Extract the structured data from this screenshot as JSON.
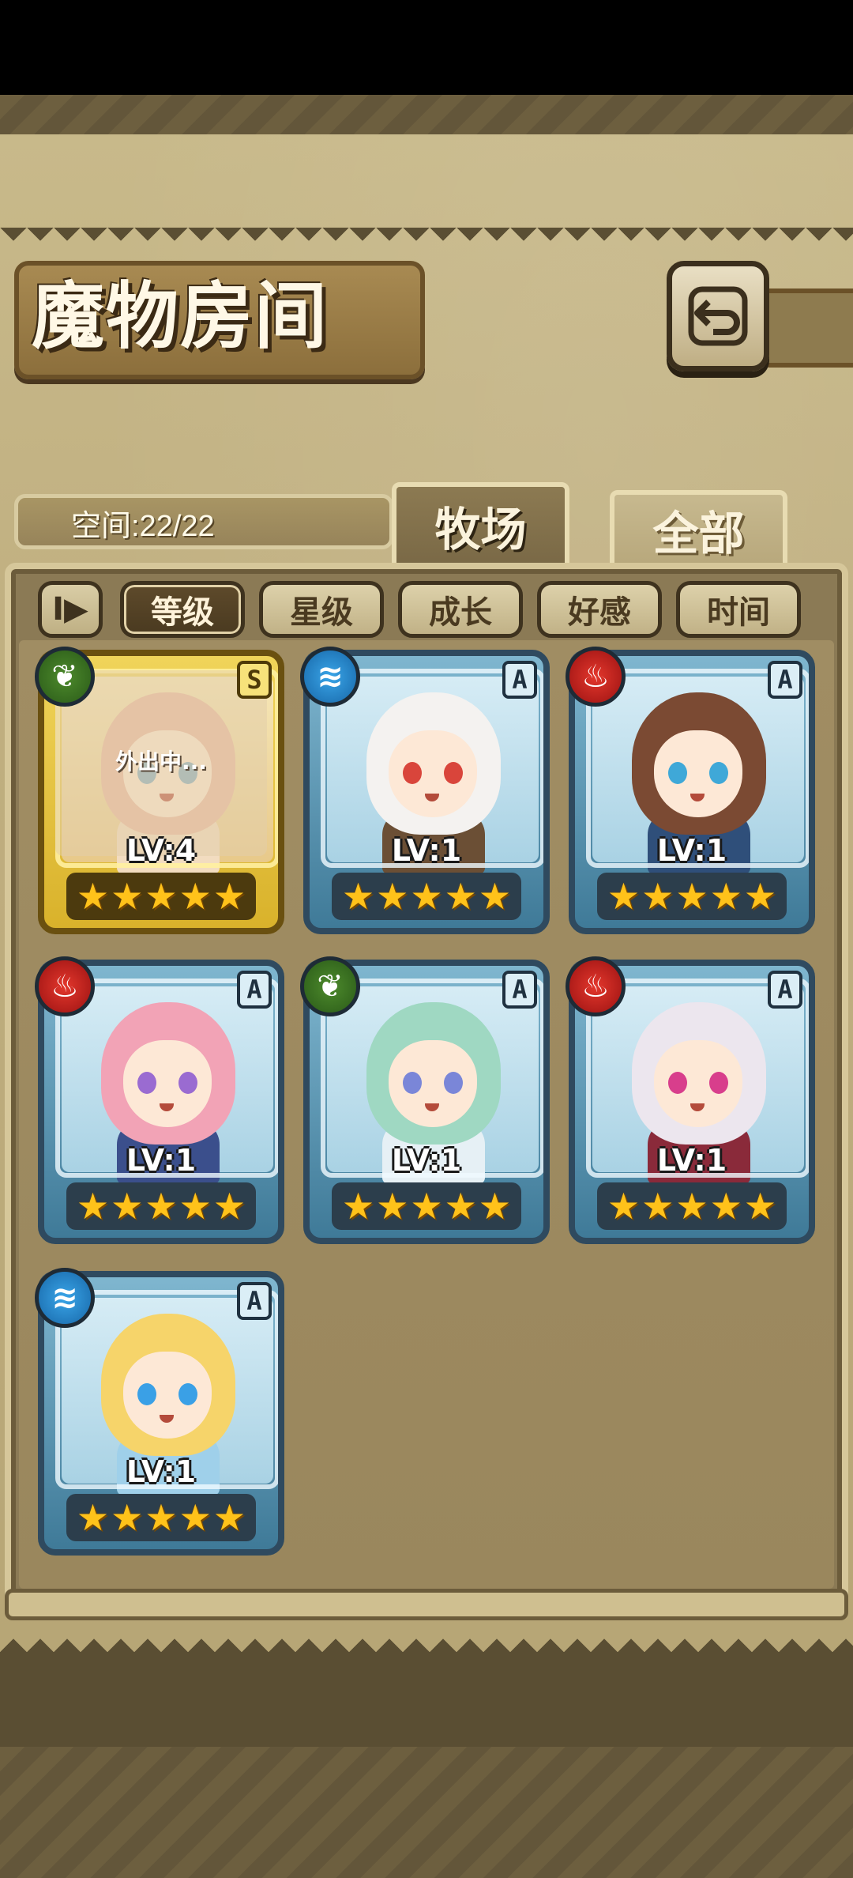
{
  "header": {
    "title": "魔物房间",
    "back_icon": "return-arrow-icon"
  },
  "info": {
    "space_label": "空间:22/22"
  },
  "tabs": [
    {
      "label": "牧场",
      "active": true
    },
    {
      "label": "全部",
      "active": false
    }
  ],
  "sort": {
    "toggle_label": "I▶",
    "buttons": [
      {
        "label": "等级",
        "active": true
      },
      {
        "label": "星级",
        "active": false
      },
      {
        "label": "成长",
        "active": false
      },
      {
        "label": "好感",
        "active": false
      },
      {
        "label": "时间",
        "active": false
      }
    ]
  },
  "cards": [
    {
      "element": "nature",
      "element_icon": "leaf-icon",
      "rank": "S",
      "level": "LV:4",
      "stars": 5,
      "frame": "gold",
      "status": "外出中...",
      "hair": "#e9b7a1",
      "eyes": "#7aa9c4",
      "outfit": "#f2dcc0"
    },
    {
      "element": "water",
      "element_icon": "wave-icon",
      "rank": "A",
      "level": "LV:1",
      "stars": 5,
      "frame": "blue",
      "status": "",
      "hair": "#f4f2f0",
      "eyes": "#d9453b",
      "outfit": "#6b4f35"
    },
    {
      "element": "fire",
      "element_icon": "flame-icon",
      "rank": "A",
      "level": "LV:1",
      "stars": 5,
      "frame": "blue",
      "status": "",
      "hair": "#7b4a33",
      "eyes": "#3fa8d8",
      "outfit": "#2f4f7a"
    },
    {
      "element": "fire",
      "element_icon": "flame-icon",
      "rank": "A",
      "level": "LV:1",
      "stars": 5,
      "frame": "blue",
      "status": "",
      "hair": "#f2a3b6",
      "eyes": "#9a6bd1",
      "outfit": "#3b4f8c"
    },
    {
      "element": "nature",
      "element_icon": "leaf-icon",
      "rank": "A",
      "level": "LV:1",
      "stars": 5,
      "frame": "blue",
      "status": "",
      "hair": "#9fd8c2",
      "eyes": "#7a86d8",
      "outfit": "#e6f0f5"
    },
    {
      "element": "fire",
      "element_icon": "flame-icon",
      "rank": "A",
      "level": "LV:1",
      "stars": 5,
      "frame": "blue",
      "status": "",
      "hair": "#ece6ee",
      "eyes": "#d83e8c",
      "outfit": "#8a2a3a"
    },
    {
      "element": "water",
      "element_icon": "wave-icon",
      "rank": "A",
      "level": "LV:1",
      "stars": 5,
      "frame": "blue",
      "status": "",
      "hair": "#f6d46a",
      "eyes": "#3aa0e6",
      "outfit": "#9fd0ea"
    }
  ]
}
